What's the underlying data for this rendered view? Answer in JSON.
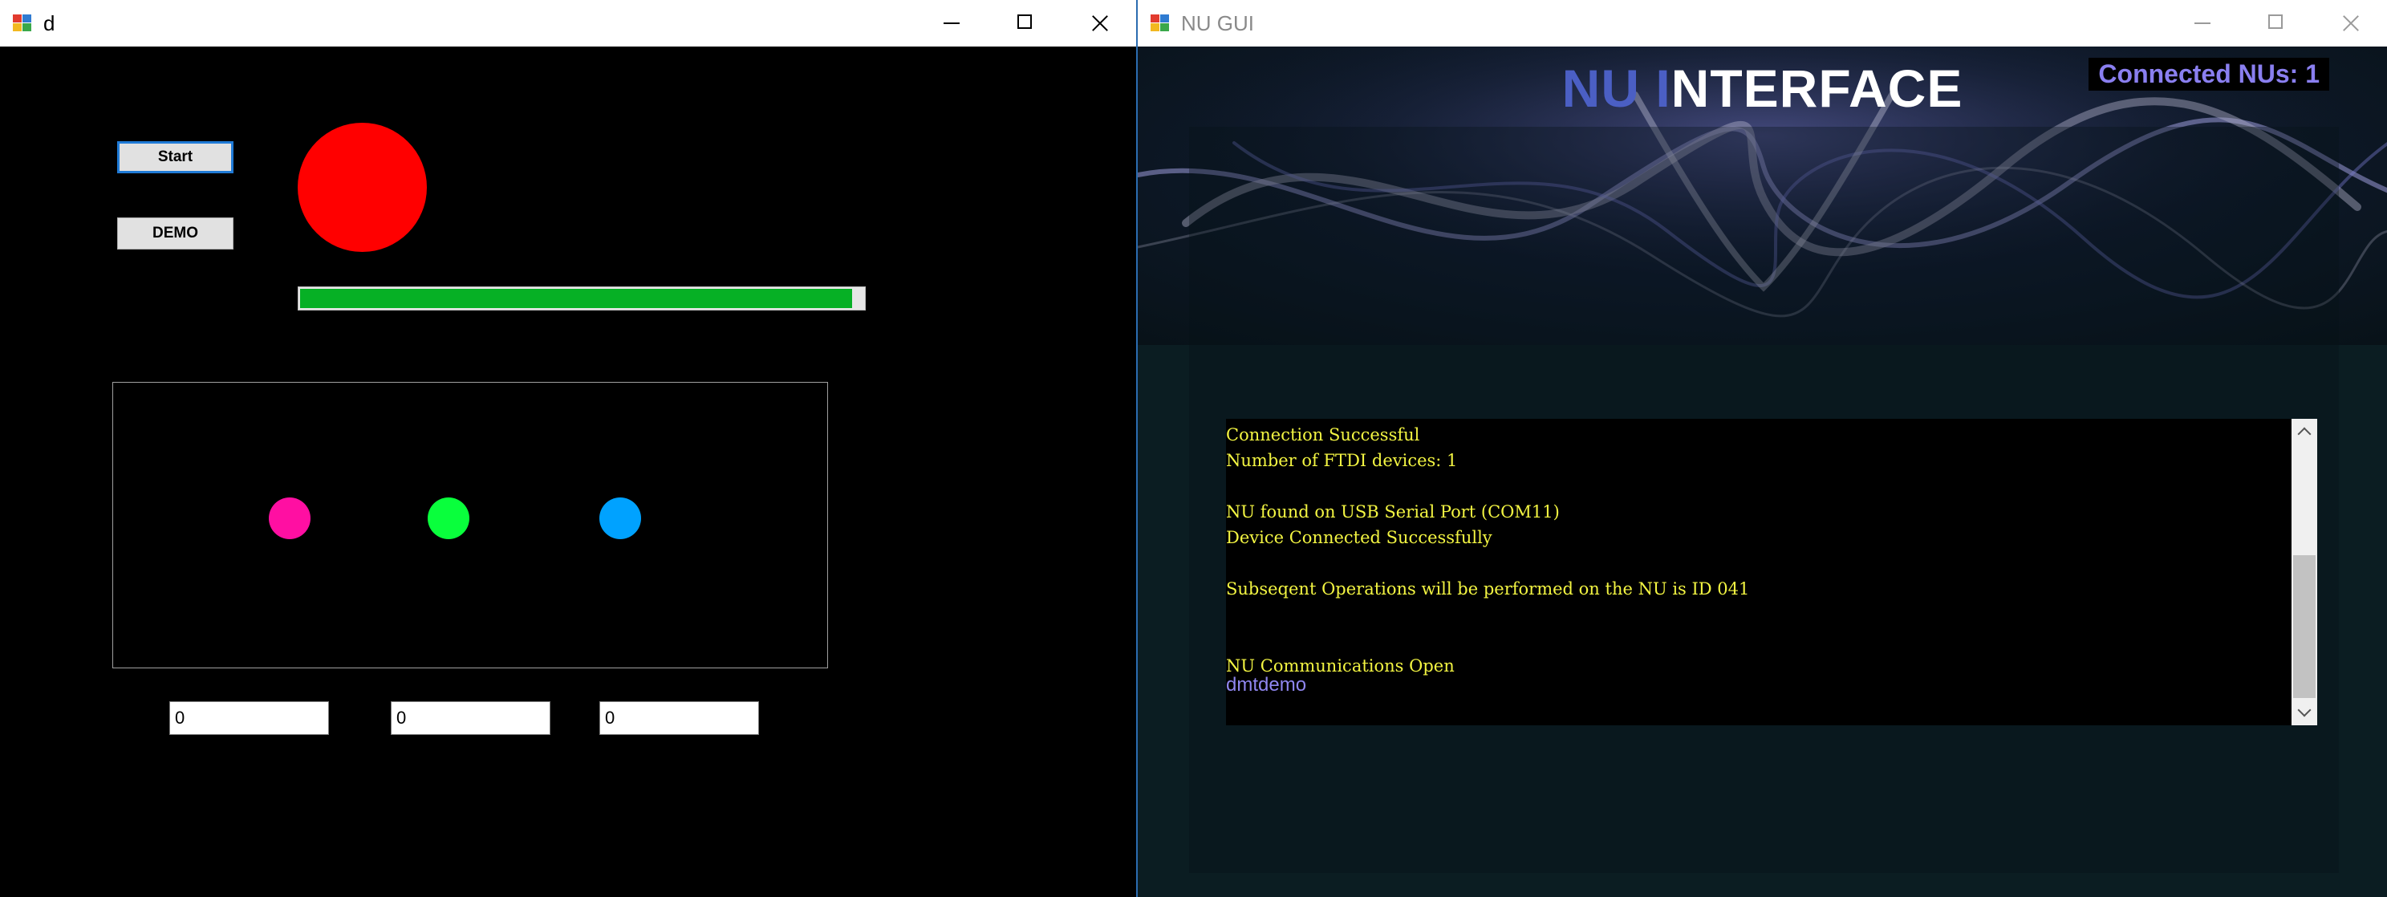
{
  "left_window": {
    "title": "d",
    "start_label": "Start",
    "demo_label": "DEMO",
    "progress": 0.98,
    "circle_color": "#ff0000",
    "dots": [
      {
        "color": "#ff0fa2"
      },
      {
        "color": "#09ff3c"
      },
      {
        "color": "#00a2ff"
      }
    ],
    "inputs": [
      "0",
      "0",
      "0"
    ]
  },
  "right_window": {
    "title": "NU GUI",
    "header_title_part1": "NU I",
    "header_title_part2": "NTERFACE",
    "connected_label": "Connected NUs: 1",
    "console_lines": [
      "Connection Successful",
      "Number of FTDI devices: 1",
      "",
      "NU found on USB Serial Port (COM11)",
      "Device Connected Successfully",
      "",
      "Subseqent Operations will be performed on the NU is ID 041",
      "",
      "",
      "NU Communications Open"
    ],
    "console_input": "dmtdemo"
  },
  "icons": {
    "app": "app-icon",
    "minimize": "minimize-icon",
    "maximize": "maximize-icon",
    "close": "close-icon",
    "scroll_up": "scroll-up-arrow-icon",
    "scroll_down": "scroll-down-arrow-icon"
  }
}
